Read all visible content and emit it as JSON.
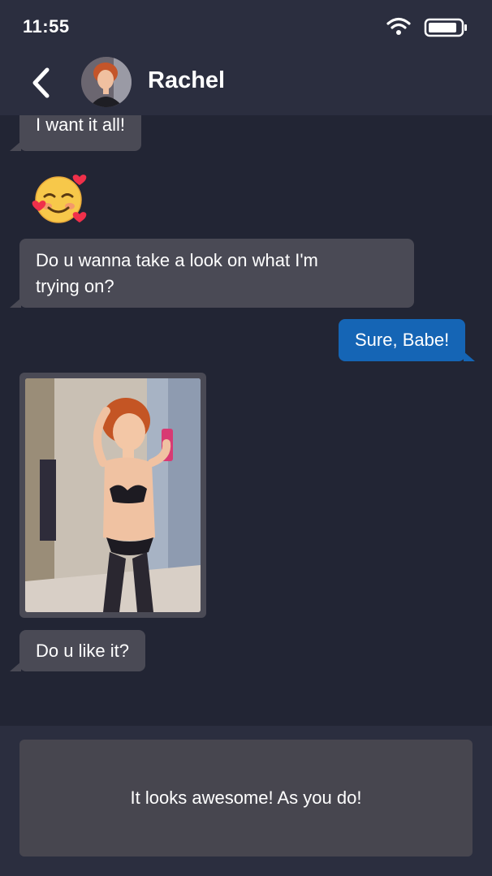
{
  "status_bar": {
    "time": "11:55",
    "wifi_icon": "wifi-icon",
    "battery_icon": "battery-icon"
  },
  "header": {
    "back_icon": "chevron-left-icon",
    "contact_name": "Rachel",
    "avatar": "contact-avatar"
  },
  "messages": [
    {
      "direction": "in",
      "text": "I want it all!"
    },
    {
      "direction": "in",
      "type": "emoji",
      "emoji": "smiling-face-with-hearts-icon"
    },
    {
      "direction": "in",
      "text_lines": [
        "Do u wanna take a look on what I'm",
        "trying on?"
      ]
    },
    {
      "direction": "out",
      "text": "Sure, Babe!"
    },
    {
      "direction": "in",
      "type": "image",
      "image": "photo"
    },
    {
      "direction": "in",
      "text": "Do u like it?"
    }
  ],
  "reply": {
    "option_text": "It looks awesome! As you do!"
  },
  "colors": {
    "background": "#222534",
    "header": "#2b2e3f",
    "incoming_bubble": "#4a4a55",
    "outgoing_bubble": "#1565b5",
    "reply_button": "#47464f"
  }
}
